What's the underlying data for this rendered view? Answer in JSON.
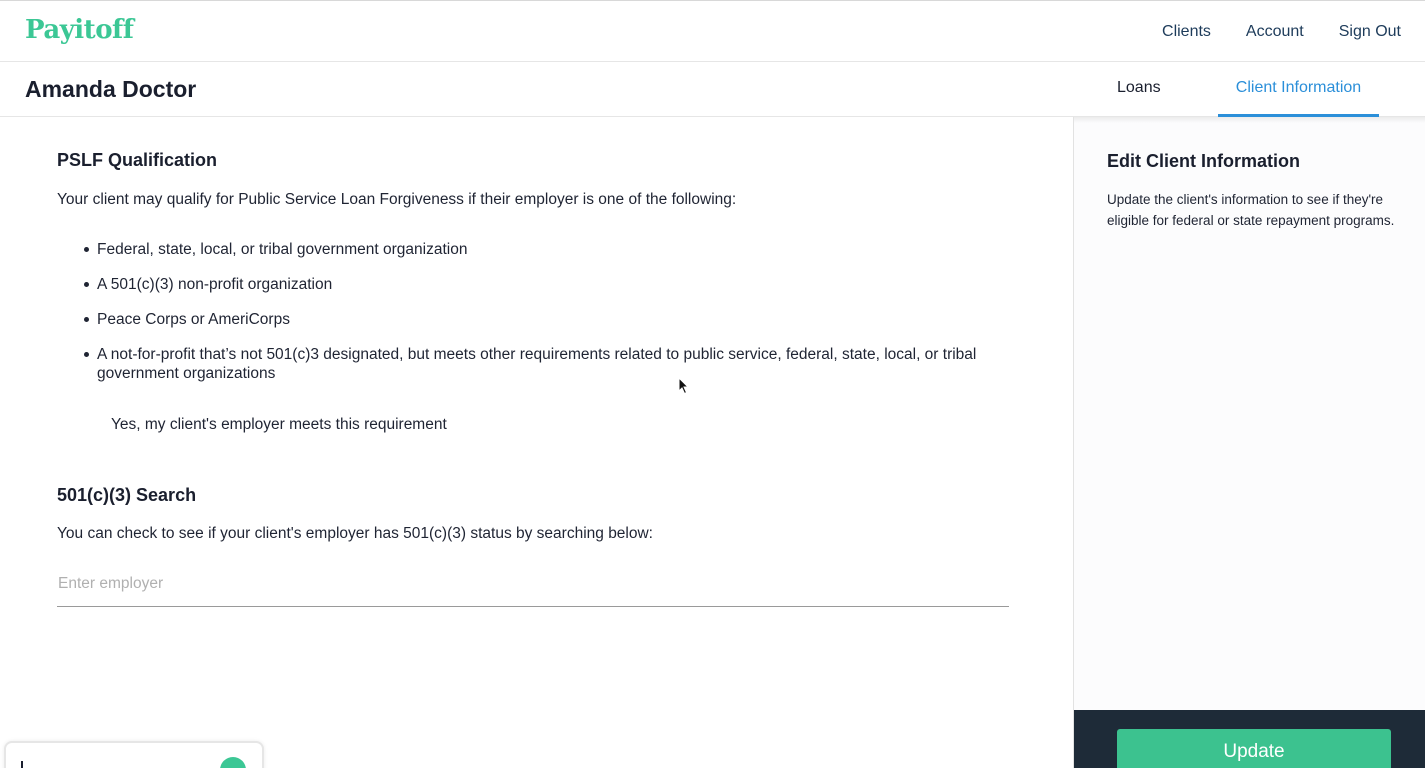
{
  "app": {
    "logo": "Payitoff",
    "brand_color": "#3cc795",
    "accent_color": "#2b8fd9"
  },
  "topnav": {
    "items": [
      "Clients",
      "Account",
      "Sign Out"
    ]
  },
  "client": {
    "name": "Amanda Doctor"
  },
  "tabs": [
    {
      "label": "Loans",
      "active": false
    },
    {
      "label": "Client Information",
      "active": true
    }
  ],
  "pslf": {
    "title": "PSLF Qualification",
    "intro": "Your client may qualify for Public Service Loan Forgiveness if their employer is one of the following:",
    "bullets": [
      "Federal, state, local, or tribal government organization",
      "A 501(c)(3) non-profit organization",
      "Peace Corps or AmeriCorps",
      "A not-for-profit that’s not 501(c)3 designated, but meets other requirements related to public service, federal, state, local, or tribal government organizations"
    ],
    "checkbox_label": "Yes, my client's employer meets this requirement",
    "checkbox_checked": false
  },
  "search": {
    "title": "501(c)(3) Search",
    "intro": "You can check to see if your client's employer has 501(c)(3) status by searching below:",
    "placeholder": "Enter employer",
    "value": ""
  },
  "sidebar": {
    "title": "Edit Client Information",
    "text": "Update the client's information to see if they're eligible for federal or state repayment programs.",
    "button_label": "Update"
  },
  "icons": {
    "cursor": "mouse-pointer-icon",
    "chat": "chat-launcher-icon"
  }
}
